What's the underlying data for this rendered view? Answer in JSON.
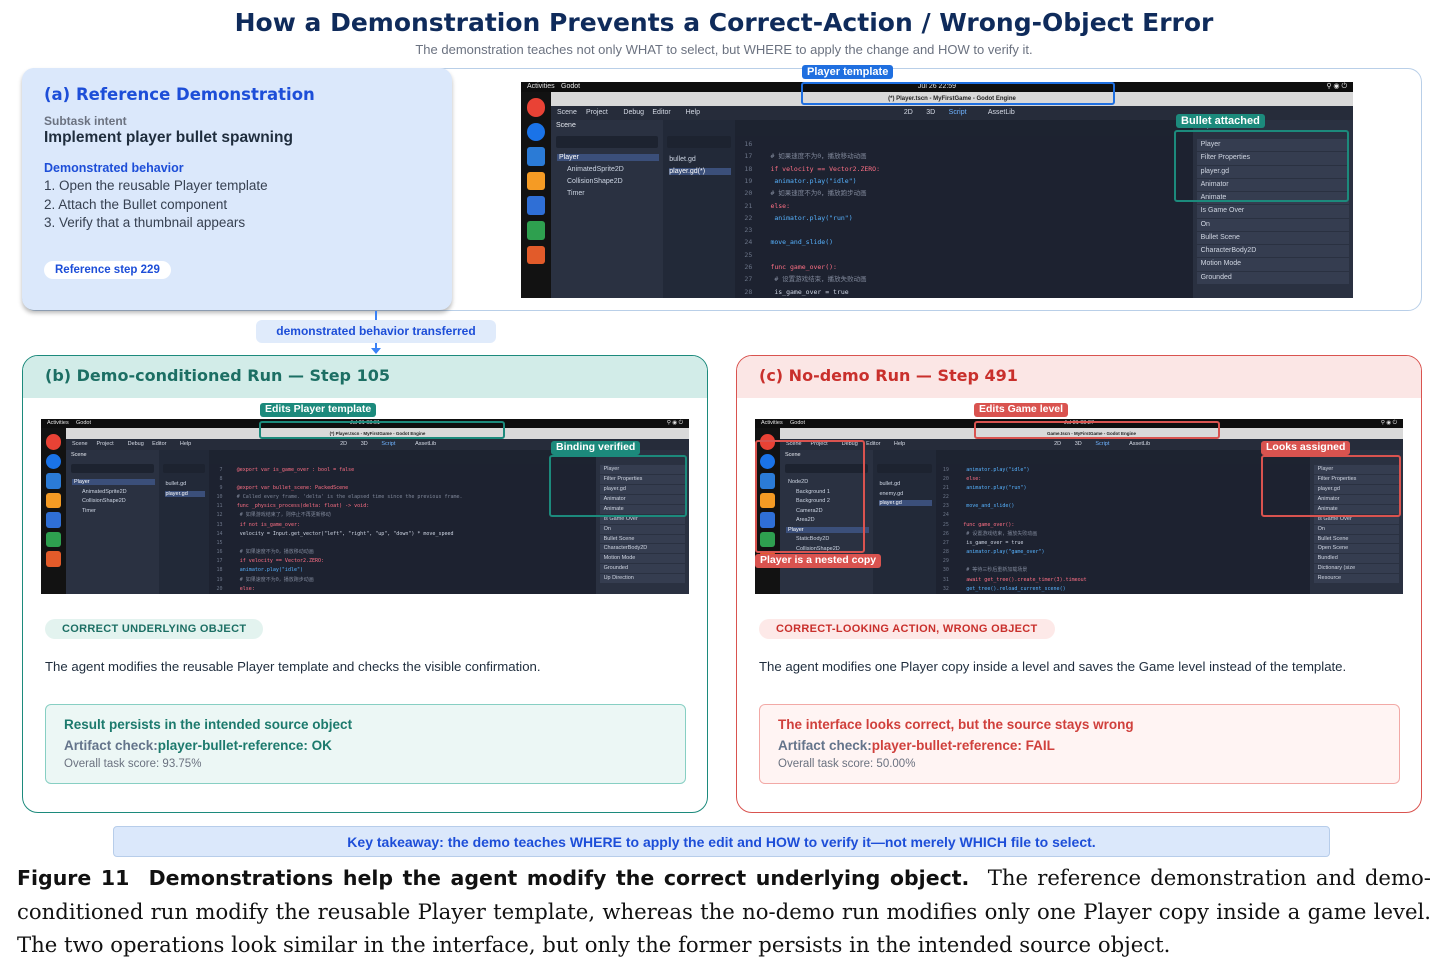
{
  "title": "How a Demonstration Prevents a Correct-Action / Wrong-Object Error",
  "subtitle": "The demonstration teaches not only WHAT to select, but WHERE to apply the change and HOW to verify it.",
  "panel_a": {
    "heading": "(a) Reference Demonstration",
    "intent_label": "Subtask intent",
    "intent": "Implement player bullet spawning",
    "behavior_label": "Demonstrated behavior",
    "steps": [
      "1. Open the reusable Player template",
      "2. Attach the Bullet component",
      "3. Verify that a thumbnail appears"
    ],
    "pill": "Reference step 229",
    "screenshot": {
      "badges": {
        "top": "Player template",
        "right": "Bullet attached"
      },
      "topbar": {
        "activities": "Activities",
        "app": "Godot",
        "clock": "Jul 26 22:59"
      },
      "window_title": "(*) Player.tscn - MyFirstGame - Godot Engine",
      "menu": [
        "Scene",
        "Project",
        "Debug",
        "Editor",
        "Help"
      ],
      "modes": [
        "2D",
        "3D",
        "Script",
        "AssetLib"
      ],
      "tree": [
        "Player",
        "AnimatedSprite2D",
        "CollisionShape2D",
        "Timer"
      ],
      "scripts": [
        "bullet.gd",
        "player.gd(*)"
      ],
      "code": [
        {
          "n": "16",
          "t": ""
        },
        {
          "n": "17",
          "t": "# 如果速度不为0，播放移动动画"
        },
        {
          "n": "18",
          "t": "if velocity == Vector2.ZERO:"
        },
        {
          "n": "19",
          "t": "    animator.play(\"idle\")"
        },
        {
          "n": "20",
          "t": "# 如果速度不为0，播放跑步动画"
        },
        {
          "n": "21",
          "t": "else:"
        },
        {
          "n": "22",
          "t": "    animator.play(\"run\")"
        },
        {
          "n": "23",
          "t": ""
        },
        {
          "n": "24",
          "t": "move_and_slide()"
        },
        {
          "n": "25",
          "t": ""
        },
        {
          "n": "26",
          "t": "func game_over():"
        },
        {
          "n": "27",
          "t": "    # 设置游戏结束，播放失败动画"
        },
        {
          "n": "28",
          "t": "    is_game_over = true"
        }
      ],
      "inspector": [
        "Player",
        "Filter Properties",
        "player.gd",
        "Animator",
        "Animate",
        "Is Game Over",
        "On",
        "Bullet Scene",
        "CharacterBody2D",
        "Motion Mode",
        "Grounded"
      ]
    }
  },
  "connector": "demonstrated behavior transferred",
  "panel_b": {
    "heading": "(b) Demo-conditioned Run — Step 105",
    "tag": "CORRECT UNDERLYING OBJECT",
    "desc": "The agent modifies the reusable Player template and checks the visible confirmation.",
    "result_title": "Result persists in the intended source object",
    "artifact_label": "Artifact check:",
    "artifact_value": "player-bullet-reference: OK",
    "score": "Overall task score: 93.75%",
    "screenshot": {
      "badges": {
        "top": "Edits Player template",
        "right": "Binding verified"
      },
      "topbar": {
        "activities": "Activities",
        "app": "Godot",
        "clock": "Jul 31 03:01"
      },
      "window_title": "(*) Player.tscn - MyFirstGame - Godot Engine",
      "tree": [
        "Player",
        "AnimatedSprite2D",
        "CollisionShape2D",
        "Timer"
      ],
      "scripts": [
        "bullet.gd",
        "player.gd"
      ],
      "code": [
        {
          "n": "7",
          "t": "@export var is_game_over : bool = false"
        },
        {
          "n": "8",
          "t": ""
        },
        {
          "n": "9",
          "t": "@export var bullet_scene: PackedScene"
        },
        {
          "n": "10",
          "t": "# Called every frame. 'delta' is the elapsed time since the previous frame."
        },
        {
          "n": "11",
          "t": "func _physics_process(delta: float) -> void:"
        },
        {
          "n": "12",
          "t": "    # 如果游戏结束了，则停止不再更新移动"
        },
        {
          "n": "13",
          "t": "    if not is_game_over:"
        },
        {
          "n": "14",
          "t": "        velocity = Input.get_vector(\"left\", \"right\", \"up\", \"down\") * move_speed"
        },
        {
          "n": "15",
          "t": ""
        },
        {
          "n": "16",
          "t": "    # 如果速度不为0，播放移动动画"
        },
        {
          "n": "17",
          "t": "    if velocity == Vector2.ZERO:"
        },
        {
          "n": "18",
          "t": "        animator.play(\"idle\")"
        },
        {
          "n": "19",
          "t": "    # 如果速度不为0，播放跑步动画"
        },
        {
          "n": "20",
          "t": "    else:"
        }
      ],
      "inspector": [
        "Player",
        "Filter Properties",
        "player.gd",
        "Animator",
        "Animate",
        "Is Game Over",
        "On",
        "Bullet Scene",
        "CharacterBody2D",
        "Motion Mode",
        "Grounded",
        "Up Direction"
      ]
    }
  },
  "panel_c": {
    "heading": "(c) No-demo Run — Step 491",
    "tag": "CORRECT-LOOKING ACTION, WRONG OBJECT",
    "desc": "The agent modifies one Player copy inside a level and saves the Game level instead of the template.",
    "result_title": "The interface looks correct, but the source stays wrong",
    "artifact_label": "Artifact check:",
    "artifact_value": "player-bullet-reference: FAIL",
    "score": "Overall task score: 50.00%",
    "screenshot": {
      "badges": {
        "top": "Edits Game level",
        "right": "Looks assigned",
        "left": "Player is a nested copy"
      },
      "topbar": {
        "activities": "Activities",
        "app": "Godot",
        "clock": "Jul 31 08:27"
      },
      "window_title": "Game.tscn - MyFirstGame - Godot Engine",
      "tree": [
        "Node2D",
        "Background 1",
        "Background 2",
        "Camera2D",
        "Area2D",
        "Player",
        "StaticBody2D",
        "CollisionShape2D",
        "StaticBody2D2"
      ],
      "scripts": [
        "bullet.gd",
        "enemy.gd",
        "player.gd"
      ],
      "code": [
        {
          "n": "19",
          "t": "        animator.play(\"idle\")"
        },
        {
          "n": "20",
          "t": "    else:"
        },
        {
          "n": "21",
          "t": "        animator.play(\"run\")"
        },
        {
          "n": "22",
          "t": ""
        },
        {
          "n": "23",
          "t": "    move_and_slide()"
        },
        {
          "n": "24",
          "t": ""
        },
        {
          "n": "25",
          "t": "func game_over():"
        },
        {
          "n": "26",
          "t": "    # 设置游戏结束，播放失败动画"
        },
        {
          "n": "27",
          "t": "    is_game_over = true"
        },
        {
          "n": "28",
          "t": "    animator.play(\"game_over\")"
        },
        {
          "n": "29",
          "t": ""
        },
        {
          "n": "30",
          "t": "    # 等待三秒后重新加载场景"
        },
        {
          "n": "31",
          "t": "    await get_tree().create_timer(3).timeout"
        },
        {
          "n": "32",
          "t": "    get_tree().reload_current_scene()"
        }
      ],
      "inspector": [
        "Player",
        "Filter Properties",
        "player.gd",
        "Animator",
        "Animate",
        "Is Game Over",
        "On",
        "Bullet Scene",
        "Open Scene",
        "Bundled",
        "Dictionary (size",
        "Resource"
      ]
    }
  },
  "key_takeaway": "Key takeaway: the demo teaches WHERE to apply the edit and HOW to verify it—not merely WHICH file to select.",
  "caption": {
    "figure_label": "Figure 11",
    "figure_title": "Demonstrations help the agent modify the correct underlying object.",
    "text": "The reference demonstration and demo-conditioned run modify the reusable Player template, whereas the no-demo run modifies only one Player copy inside a game level. The two operations look similar in the interface, but only the former persists in the intended source object."
  },
  "colors": {
    "navy": "#0f2b5b",
    "blue_accent": "#1d4ed8",
    "teal": "#1c8a7c",
    "red": "#d9534f"
  }
}
